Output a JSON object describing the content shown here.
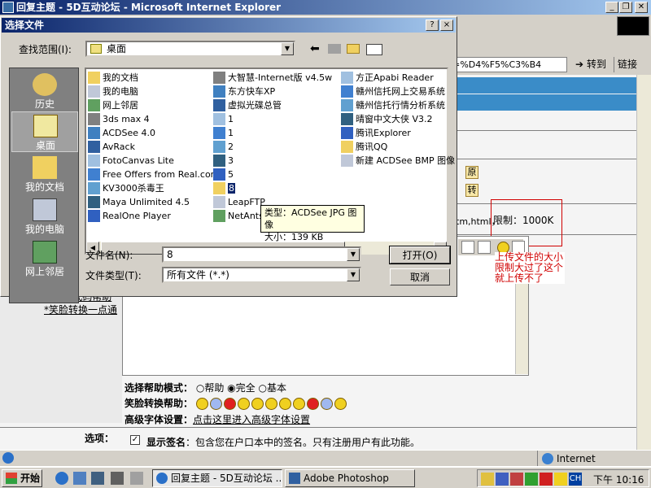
{
  "ie": {
    "title": "回复主题 - 5D互动论坛 - Microsoft Internet Explorer",
    "address_value": "ect=%D4%F5%C3%B4",
    "goto_label": "转到",
    "links_label": "链接",
    "status_text": "Internet"
  },
  "page": {
    "limit_text": "限制：1000K",
    "file_types_fragment": "tm,html，",
    "annotation": "上传文件的大小限制大过了这个就上传不了",
    "left_link1": "*笑脸转换一点通",
    "left_link0": "*UBB代码帮助",
    "btn_yuan": "原",
    "btn_zhuan": "转",
    "help_mode_label": "选择帮助模式：",
    "help_opt1": "帮助",
    "help_opt2": "完全",
    "help_opt3": "基本",
    "smiley_label": "笑脸转换帮助：",
    "font_label": "高级字体设置：",
    "font_link": "点击这里进入高级字体设置",
    "options_label": "选项：",
    "signature_label": "显示签名",
    "signature_desc": "包含您在户口本中的签名。只有注册用户有此功能。"
  },
  "dialog": {
    "title": "选择文件",
    "help_btn": "?",
    "close_btn": "×",
    "lookin_label": "查找范围(I):",
    "lookin_value": "桌面",
    "places": [
      {
        "label": "历史"
      },
      {
        "label": "桌面"
      },
      {
        "label": "我的文档"
      },
      {
        "label": "我的电脑"
      },
      {
        "label": "网上邻居"
      }
    ],
    "files_col1": [
      "我的文档",
      "我的电脑",
      "网上邻居",
      "3ds max 4",
      "ACDSee 4.0",
      "AvRack",
      "FotoCanvas Lite",
      "Free Offers from Real.com",
      "KV3000杀毒王",
      "Maya Unlimited 4.5",
      "RealOne Player"
    ],
    "files_col2": [
      "大智慧-Internet版 v4.5w",
      "东方快车XP",
      "虚拟光碟总管",
      "1",
      "1",
      "2",
      "3",
      "5",
      "8",
      "LeapFTP",
      "NetAnts"
    ],
    "files_col3": [
      "方正Apabi Reader",
      "赣州信托网上交易系统",
      "赣州信托行情分析系统",
      "晴窗中文大侠 V3.2",
      "腾讯Explorer",
      "腾讯QQ",
      "新建 ACDSee BMP 图像"
    ],
    "tooltip_type": "类型：ACDSee JPG 图像",
    "tooltip_size": "大小：139 KB",
    "filename_label": "文件名(N):",
    "filename_value": "8",
    "filetype_label": "文件类型(T):",
    "filetype_value": "所有文件 (*.*)",
    "open_btn": "打开(O)",
    "cancel_btn": "取消"
  },
  "taskbar": {
    "start": "开始",
    "task1": "回复主题 - 5D互动论坛 ...",
    "task2": "Adobe Photoshop",
    "tray_ch": "CH",
    "clock": "下午 10:16"
  },
  "colors": {
    "title_active": "#0a246a",
    "face": "#d4d0c8",
    "annotation": "#d00000",
    "selection": "#0a246a"
  }
}
